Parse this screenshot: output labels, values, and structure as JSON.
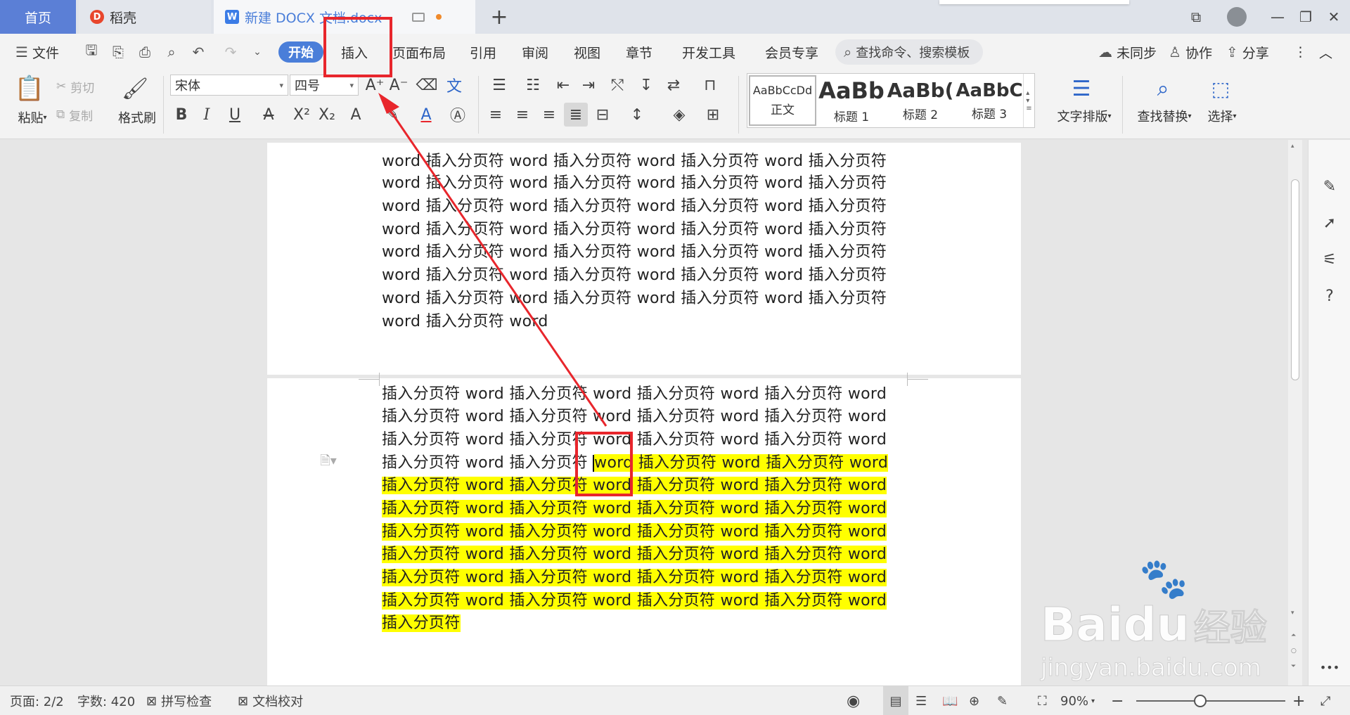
{
  "titlebar": {
    "tabs": [
      {
        "label": "首页"
      },
      {
        "label": "稻壳"
      },
      {
        "label": "新建 DOCX 文档.docx"
      }
    ],
    "new_tab": "+"
  },
  "menubar": {
    "file_label": "文件",
    "tabs": [
      "开始",
      "插入",
      "页面布局",
      "引用",
      "审阅",
      "视图",
      "章节",
      "开发工具",
      "会员专享"
    ],
    "search_placeholder": "查找命令、搜索模板",
    "right": [
      "未同步",
      "协作",
      "分享"
    ]
  },
  "ribbon": {
    "paste": "粘贴",
    "cut": "剪切",
    "copy": "复制",
    "format_painter": "格式刷",
    "font_name": "宋体",
    "font_size": "四号",
    "styles": [
      {
        "sample": "AaBbCcDd",
        "name": "正文"
      },
      {
        "sample": "AaBb",
        "name": "标题 1"
      },
      {
        "sample": "AaBb(",
        "name": "标题 2"
      },
      {
        "sample": "AaBbC",
        "name": "标题 3"
      }
    ],
    "text_layout": "文字排版",
    "find_replace": "查找替换",
    "select": "选择"
  },
  "document": {
    "page1_lines": [
      "word 插入分页符 word 插入分页符 word 插入分页符 word 插入分页符",
      "word 插入分页符 word 插入分页符 word 插入分页符 word 插入分页符",
      "word 插入分页符 word 插入分页符 word 插入分页符 word 插入分页符",
      "word 插入分页符 word 插入分页符 word 插入分页符 word 插入分页符",
      "word 插入分页符 word 插入分页符 word 插入分页符 word 插入分页符",
      "word 插入分页符 word 插入分页符 word 插入分页符 word 插入分页符",
      "word 插入分页符 word 插入分页符 word 插入分页符 word 插入分页符",
      "word 插入分页符 word"
    ],
    "page2_plain_lines": [
      "插入分页符 word 插入分页符 word 插入分页符 word 插入分页符 word",
      "插入分页符 word 插入分页符 word 插入分页符 word 插入分页符 word",
      "插入分页符 word 插入分页符 word 插入分页符 word 插入分页符 word"
    ],
    "page2_split_line": {
      "plain": "插入分页符 word 插入分页符 ",
      "highlighted": "word 插入分页符 word 插入分页符 word"
    },
    "page2_highlight_lines": [
      "插入分页符 word 插入分页符 word 插入分页符 word 插入分页符 word",
      "插入分页符 word 插入分页符 word 插入分页符 word 插入分页符 word",
      "插入分页符 word 插入分页符 word 插入分页符 word 插入分页符 word",
      "插入分页符 word 插入分页符 word 插入分页符 word 插入分页符 word",
      "插入分页符 word 插入分页符 word 插入分页符 word 插入分页符 word",
      "插入分页符 word 插入分页符 word 插入分页符 word 插入分页符 word",
      "插入分页符"
    ],
    "highlight_color": "#ffff00"
  },
  "statusbar": {
    "page": "页面: 2/2",
    "word_count": "字数: 420",
    "spellcheck": "拼写检查",
    "proofread": "文档校对",
    "zoom": "90%"
  },
  "watermark": {
    "brand": "Bai",
    "brand2": "du",
    "cn": "经验",
    "url": "jingyan.baidu.com"
  },
  "colors": {
    "accent": "#4a7ed9",
    "annotation": "#e8262c"
  }
}
